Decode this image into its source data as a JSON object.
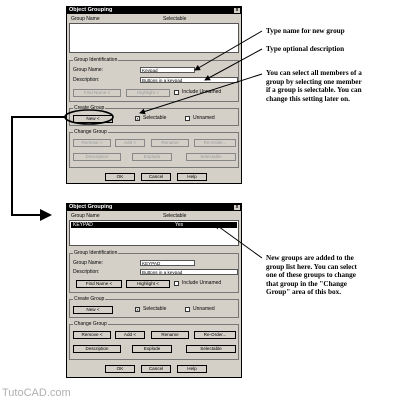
{
  "dialog1": {
    "title": "Object Grouping",
    "close": "x",
    "col_group_name": "Group Name",
    "col_selectable": "Selectable",
    "identification_label": "Group Identification",
    "group_name_label": "Group Name:",
    "group_name_value": "Keypad",
    "description_label": "Description:",
    "description_value": "Buttons in a keypad",
    "find_name": "Find Name <",
    "highlight": "Highlight <",
    "include_unnamed": "Include Unnamed",
    "create_label": "Create Group",
    "new_btn": "New <",
    "selectable": "Selectable",
    "unnamed": "Unnamed",
    "selectable_checked": "x",
    "change_label": "Change Group",
    "change_row1": [
      "Remove <",
      "Add <",
      "Rename",
      "Re-Order..."
    ],
    "change_row2": [
      "Description",
      "Explode",
      "Selectable"
    ],
    "ok": "OK",
    "cancel": "Cancel",
    "help": "Help"
  },
  "dialog2": {
    "title": "Object Grouping",
    "close": "x",
    "col_group_name": "Group Name",
    "col_selectable": "Selectable",
    "row_name": "KEYPAD",
    "row_selectable": "Yes",
    "identification_label": "Group Identification",
    "group_name_label": "Group Name:",
    "group_name_value": "KEYPAD",
    "description_label": "Description:",
    "description_value": "Buttons in a keypad",
    "find_name": "Find Name <",
    "highlight": "Highlight <",
    "include_unnamed": "Include Unnamed",
    "create_label": "Create Group",
    "new_btn": "New <",
    "selectable": "Selectable",
    "unnamed": "Unnamed",
    "selectable_checked": "x",
    "change_label": "Change Group",
    "change_row1": [
      "Remove <",
      "Add <",
      "Rename",
      "Re-Order..."
    ],
    "change_row2": [
      "Description",
      "Explode",
      "Selectable"
    ],
    "ok": "OK",
    "cancel": "Cancel",
    "help": "Help"
  },
  "annotations": {
    "type_name": "Type name for new group",
    "type_description": "Type optional description",
    "select_members": [
      "You can select all members of a",
      "group by selecting one member",
      "if a group is selectable. You can",
      "change this setting later on."
    ],
    "new_groups": [
      "New groups are added to the",
      "group list here. You can select",
      "one of these groups to change",
      "that group in the \"Change",
      "Group\" area of this box."
    ]
  },
  "watermark": "TutoCAD.com"
}
